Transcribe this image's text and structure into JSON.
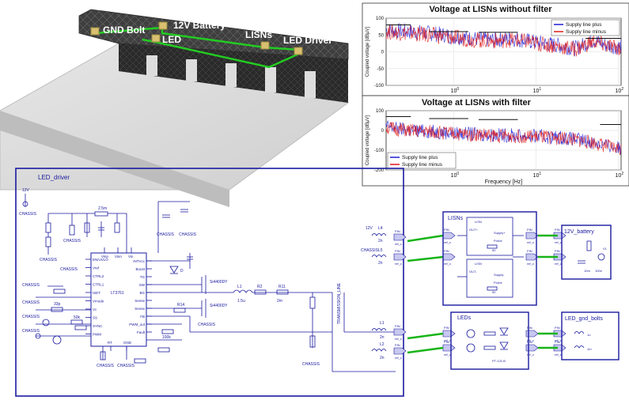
{
  "scene": {
    "labels": {
      "gnd_bolt": "GND Bolt",
      "battery": "12V Battery",
      "led": "LED",
      "lisns": "LISNs",
      "led_driver": "LED Driver"
    }
  },
  "chart_data": [
    {
      "type": "line",
      "title": "Voltage at LISNs without filter",
      "xlabel": "",
      "ylabel": "Coupled voltage [dBµV]",
      "xscale": "log",
      "xlim": [
        0.15,
        108
      ],
      "ylim": [
        -100,
        100
      ],
      "yticks": [
        100,
        50,
        0,
        -50,
        -100
      ],
      "xticks": [
        {
          "v": 1,
          "label": "10^0"
        },
        {
          "v": 10,
          "label": "10^1"
        },
        {
          "v": 100,
          "label": "10^2"
        }
      ],
      "legend": "top-right",
      "series": [
        {
          "name": "Supply line plus",
          "color": "#1f1fd6",
          "x": [
            0.15,
            0.2,
            0.3,
            0.5,
            0.8,
            1,
            2,
            3,
            5,
            8,
            10,
            20,
            30,
            50,
            70,
            100
          ],
          "y": [
            65,
            62,
            60,
            55,
            50,
            45,
            38,
            35,
            40,
            32,
            28,
            18,
            10,
            35,
            20,
            15
          ]
        },
        {
          "name": "Supply line minus",
          "color": "#e01818",
          "x": [
            0.15,
            0.2,
            0.3,
            0.5,
            0.8,
            1,
            2,
            3,
            5,
            8,
            10,
            20,
            30,
            50,
            70,
            100
          ],
          "y": [
            60,
            58,
            55,
            50,
            45,
            42,
            35,
            32,
            36,
            30,
            25,
            15,
            8,
            30,
            18,
            12
          ]
        }
      ]
    },
    {
      "type": "line",
      "title": "Voltage at LISNs with filter",
      "xlabel": "Frequency [Hz]",
      "ylabel": "Coupled voltage [dBµV]",
      "xscale": "log",
      "xlim": [
        0.15,
        108
      ],
      "ylim": [
        -200,
        100
      ],
      "yticks": [
        100,
        0,
        -100,
        -200
      ],
      "xticks": [
        {
          "v": 1,
          "label": "10^0"
        },
        {
          "v": 10,
          "label": "10^1"
        },
        {
          "v": 100,
          "label": "10^2"
        }
      ],
      "legend": "bottom-left",
      "series": [
        {
          "name": "Supply line plus",
          "color": "#1f1fd6",
          "x": [
            0.15,
            0.2,
            0.3,
            0.5,
            0.8,
            1,
            2,
            3,
            5,
            8,
            10,
            20,
            30,
            50,
            70,
            100
          ],
          "y": [
            20,
            10,
            0,
            -5,
            -10,
            -15,
            -20,
            -22,
            -25,
            -28,
            -30,
            -35,
            -45,
            -60,
            -75,
            -90
          ]
        },
        {
          "name": "Supply line minus",
          "color": "#e01818",
          "x": [
            0.15,
            0.2,
            0.3,
            0.5,
            0.8,
            1,
            2,
            3,
            5,
            8,
            10,
            20,
            30,
            50,
            70,
            100
          ],
          "y": [
            15,
            5,
            -3,
            -8,
            -12,
            -18,
            -22,
            -25,
            -28,
            -30,
            -33,
            -38,
            -48,
            -62,
            -78,
            -92
          ]
        }
      ]
    }
  ],
  "schematic": {
    "led_driver": {
      "title": "LED_driver",
      "ic_name": "LT3761",
      "ic_pins_left": [
        "EN/UVLO",
        "Vref",
        "CTRL2",
        "CTRL1",
        "ISET",
        "Vmode",
        "Vc",
        "SS",
        "SYNC",
        "PWM"
      ],
      "ic_pins_right": [
        "INTVcc",
        "Boost",
        "TG",
        "SW",
        "BG",
        "Sense",
        "Sense",
        "FB",
        "PWM_out",
        "Fault"
      ],
      "ic_pins_top": [
        "Vinp",
        "Vinn",
        "Vin"
      ],
      "ic_pins_bottom": [
        "RT",
        "GND"
      ],
      "mosfets": [
        "Si4400DY",
        "Si4400DY"
      ],
      "diode": "D",
      "inductor": "L1",
      "resistors": [
        "R1",
        "R2",
        "R11",
        "R12",
        "R14"
      ],
      "inductor_values": [
        "1.5u",
        "2m"
      ],
      "chassis": "CHASSIS",
      "vsupply": "12V",
      "values": [
        "2.5m",
        "100n",
        "10u",
        "5.1k",
        "4.7u",
        "1u",
        "33p",
        "50k",
        "4.7n",
        "100k"
      ]
    },
    "lisns": {
      "title": "LISNs",
      "block_label": "LISN",
      "pins": [
        "OUT+",
        "Supply+",
        "Probe",
        "OUT-",
        "Supply-",
        "Probe"
      ],
      "resistor": "50"
    },
    "battery": {
      "title": "12V_battery",
      "source": "V1",
      "values": [
        "10m",
        "100n"
      ]
    },
    "leds": {
      "title": "LEDs",
      "part": "PT-121-B"
    },
    "gnd": {
      "title": "LED_gnd_bolts",
      "values": [
        "1u",
        "1m"
      ]
    },
    "ports": {
      "pin": "PIN",
      "ref": "ref_c",
      "wire_labels": [
        "12V",
        "L4",
        "CHASSIS",
        "L5",
        "L1",
        "L2"
      ],
      "inductances": [
        "2n",
        "2n",
        "2n",
        "2n"
      ],
      "vertical_label": "TRANSMISSION_LINE"
    }
  }
}
